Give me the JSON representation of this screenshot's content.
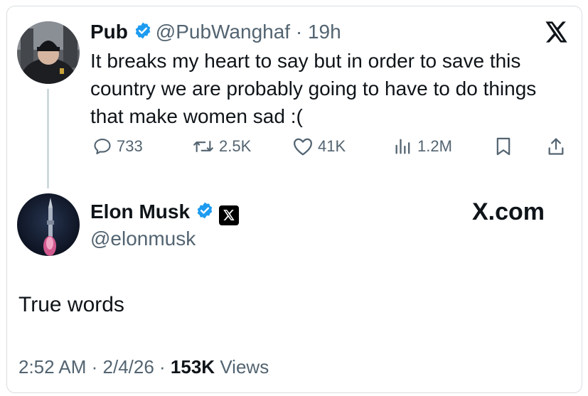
{
  "reply_tweet": {
    "author_name": "Pub",
    "handle": "@PubWanghaf",
    "separator": " · ",
    "time": "19h",
    "text": "It breaks my heart to say but in order to save this country we are probably going to have to do things that make women sad :(",
    "stats": {
      "replies": "733",
      "reposts": "2.5K",
      "likes": "41K",
      "views": "1.2M"
    }
  },
  "main_tweet": {
    "author_name": "Elon Musk",
    "handle": "@elonmusk",
    "watermark": "X.com",
    "text": "True words",
    "time": "2:52 AM",
    "date": "2/4/26",
    "sep": " · ",
    "views_count": "153K",
    "views_label": "Views"
  },
  "colors": {
    "verified_blue": "#1d9bf0",
    "secondary_text": "#536471",
    "text": "#0f1419"
  },
  "icons": [
    "verified-badge-icon",
    "x-logo-icon",
    "reply-icon",
    "repost-icon",
    "like-icon",
    "views-icon",
    "bookmark-icon",
    "share-icon"
  ]
}
